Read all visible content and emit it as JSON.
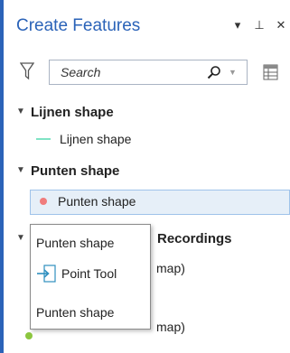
{
  "pane": {
    "title": "Create Features",
    "controls": {
      "menu": "▾",
      "pin": "⊥",
      "close": "✕"
    }
  },
  "search": {
    "placeholder": "Search",
    "icon": "search-icon"
  },
  "groups": [
    {
      "header": "Lijnen shape",
      "items": [
        {
          "label": "Lijnen shape",
          "symbol": "line",
          "color": "#7fe3c4"
        }
      ]
    },
    {
      "header": "Punten shape",
      "items": [
        {
          "label": "Punten shape",
          "symbol": "point",
          "color": "#f07c7c",
          "selected": true
        }
      ]
    },
    {
      "header": "Recordings",
      "items": [
        {
          "label": "map)",
          "symbol": "point"
        },
        {
          "label": "map)",
          "symbol": "point",
          "color": "#8cc63f"
        }
      ]
    }
  ],
  "popup": {
    "title": "Punten shape",
    "tool_label": "Point Tool",
    "subtitle": "Punten shape"
  },
  "colors": {
    "accent": "#2b63b8",
    "selected_bg": "#e6eff8",
    "selected_border": "#9fc3ea"
  }
}
